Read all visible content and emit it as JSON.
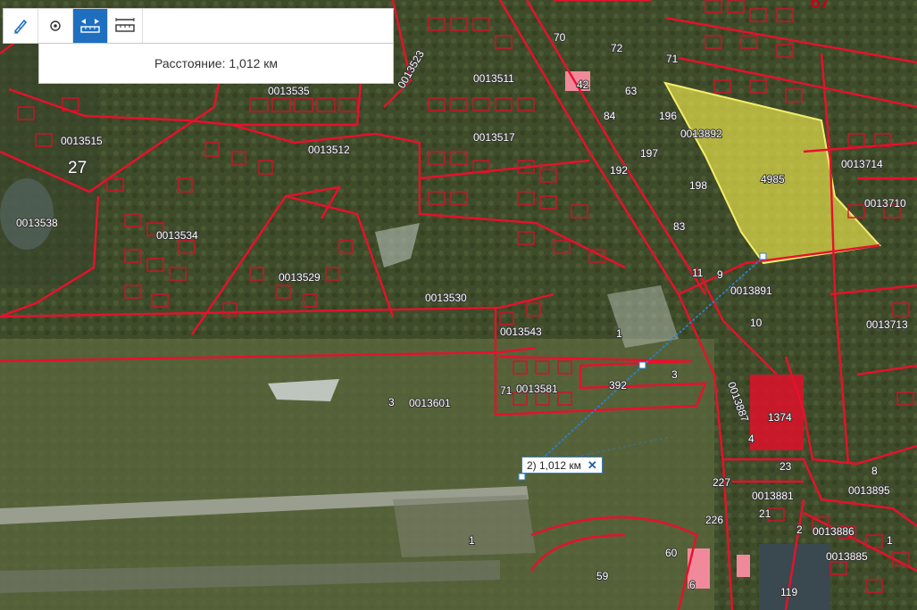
{
  "toolbar": {
    "tools": [
      {
        "name": "ruler-pencil-icon",
        "active": false
      },
      {
        "name": "point-target-icon",
        "active": false
      },
      {
        "name": "distance-measure-icon",
        "active": true
      },
      {
        "name": "area-measure-icon",
        "active": false
      }
    ]
  },
  "measure_panel": {
    "text": "Расстояние: 1,012 км"
  },
  "measure_label": {
    "text": "2) 1,012 км",
    "close": "✕"
  },
  "map": {
    "parcel_labels": [
      "0013515",
      "27",
      "0013538",
      "0013534",
      "0013535",
      "0013523",
      "0013511",
      "0013512",
      "0013517",
      "0013529",
      "0013530",
      "0013543",
      "0013601",
      "0013581",
      "0013891",
      "0013892",
      "4985",
      "0013714",
      "0013710",
      "0013713",
      "0013887",
      "1374",
      "0013881",
      "0013895",
      "0013886",
      "0013885",
      "70",
      "72",
      "71",
      "67",
      "42",
      "63",
      "84",
      "83",
      "196",
      "197",
      "198",
      "192",
      "11",
      "9",
      "10",
      "1",
      "3",
      "392",
      "71",
      "8",
      "4",
      "23",
      "227",
      "226",
      "21",
      "2",
      "60",
      "59",
      "119",
      "6",
      "1",
      "3",
      "1"
    ],
    "colors": {
      "parcel_border": "#d8102a",
      "selected_fill": "#e6e04a",
      "measure_line": "#2a7fd0",
      "pink_building": "#f08a9a"
    }
  }
}
